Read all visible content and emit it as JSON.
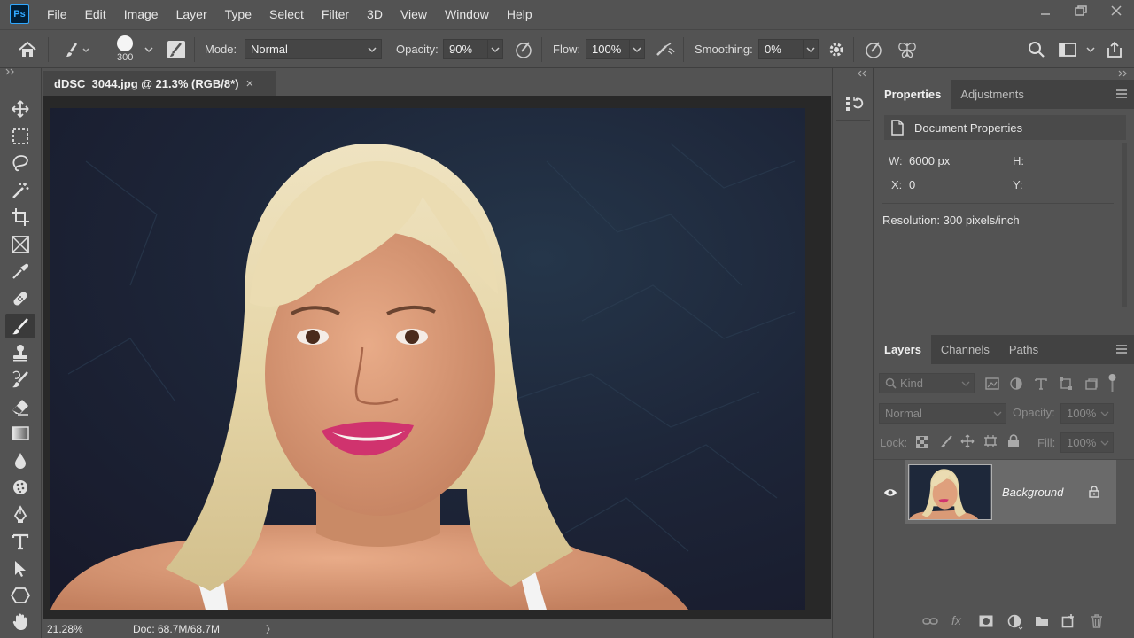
{
  "app": {
    "logo": "Ps"
  },
  "menu": [
    "File",
    "Edit",
    "Image",
    "Layer",
    "Type",
    "Select",
    "Filter",
    "3D",
    "View",
    "Window",
    "Help"
  ],
  "options": {
    "brush_size": "300",
    "mode_label": "Mode:",
    "mode_value": "Normal",
    "opacity_label": "Opacity:",
    "opacity_value": "90%",
    "flow_label": "Flow:",
    "flow_value": "100%",
    "smoothing_label": "Smoothing:",
    "smoothing_value": "0%"
  },
  "document": {
    "tab_title": "dDSC_3044.jpg @ 21.3% (RGB/8*)",
    "close_glyph": "×",
    "zoom": "21.28%",
    "doc_size": "Doc: 68.7M/68.7M",
    "status_arrow": "〉"
  },
  "properties": {
    "tabs": [
      "Properties",
      "Adjustments"
    ],
    "section_title": "Document Properties",
    "w_label": "W:",
    "w_value": "6000 px",
    "h_label": "H:",
    "x_label": "X:",
    "x_value": "0",
    "y_label": "Y:",
    "resolution": "Resolution: 300 pixels/inch"
  },
  "layers_panel": {
    "tabs": [
      "Layers",
      "Channels",
      "Paths"
    ],
    "kind_placeholder": "Kind",
    "blend_mode": "Normal",
    "opacity_label": "Opacity:",
    "opacity_value": "100%",
    "lock_label": "Lock:",
    "fill_label": "Fill:",
    "fill_value": "100%",
    "layer_name": "Background",
    "fx_label": "fx"
  },
  "colors": {
    "chrome": "#535353",
    "panel_dark": "#424242",
    "canvas_bg": "#282828",
    "accent": "#31a8ff"
  },
  "icons": {
    "tools": [
      "move-icon",
      "marquee-icon",
      "lasso-icon",
      "magic-wand-icon",
      "crop-icon",
      "frame-icon",
      "eyedropper-icon",
      "healing-icon",
      "brush-icon",
      "stamp-icon",
      "history-brush-icon",
      "eraser-icon",
      "gradient-icon",
      "blur-icon",
      "sponge-icon",
      "pen-icon",
      "type-icon",
      "path-select-icon",
      "shape-icon",
      "hand-icon"
    ]
  }
}
